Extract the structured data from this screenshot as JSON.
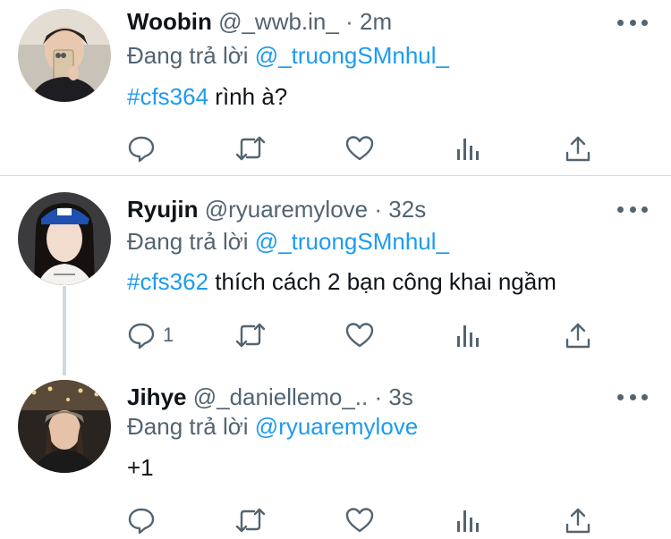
{
  "tweets": [
    {
      "name": "Woobin",
      "handle": "@_wwb.in_",
      "dot": "·",
      "time": "2m",
      "reply_prefix": "Đang trả lời",
      "reply_to": "@_truongSMnhul_",
      "hashtag": "#cfs364",
      "text": " rình à?",
      "reply_count": ""
    },
    {
      "name": "Ryujin",
      "handle": "@ryuaremylove",
      "dot": "·",
      "time": "32s",
      "reply_prefix": "Đang trả lời",
      "reply_to": "@_truongSMnhul_",
      "hashtag": "#cfs362",
      "text": " thích cách 2 bạn công khai ngầm",
      "reply_count": "1"
    },
    {
      "name": "Jihye",
      "handle": "@_daniellemo_..",
      "dot": "·",
      "time": "3s",
      "reply_prefix": "Đang trả lời",
      "reply_to": "@ryuaremylove",
      "hashtag": "",
      "text": "+1",
      "reply_count": ""
    }
  ],
  "icons": [
    "reply-icon",
    "retweet-icon",
    "like-icon",
    "analytics-icon",
    "share-icon",
    "more-icon"
  ],
  "colors": {
    "link": "#1d9bf0",
    "muted": "#536471",
    "text": "#0f1419",
    "divider": "#cfd9de"
  }
}
